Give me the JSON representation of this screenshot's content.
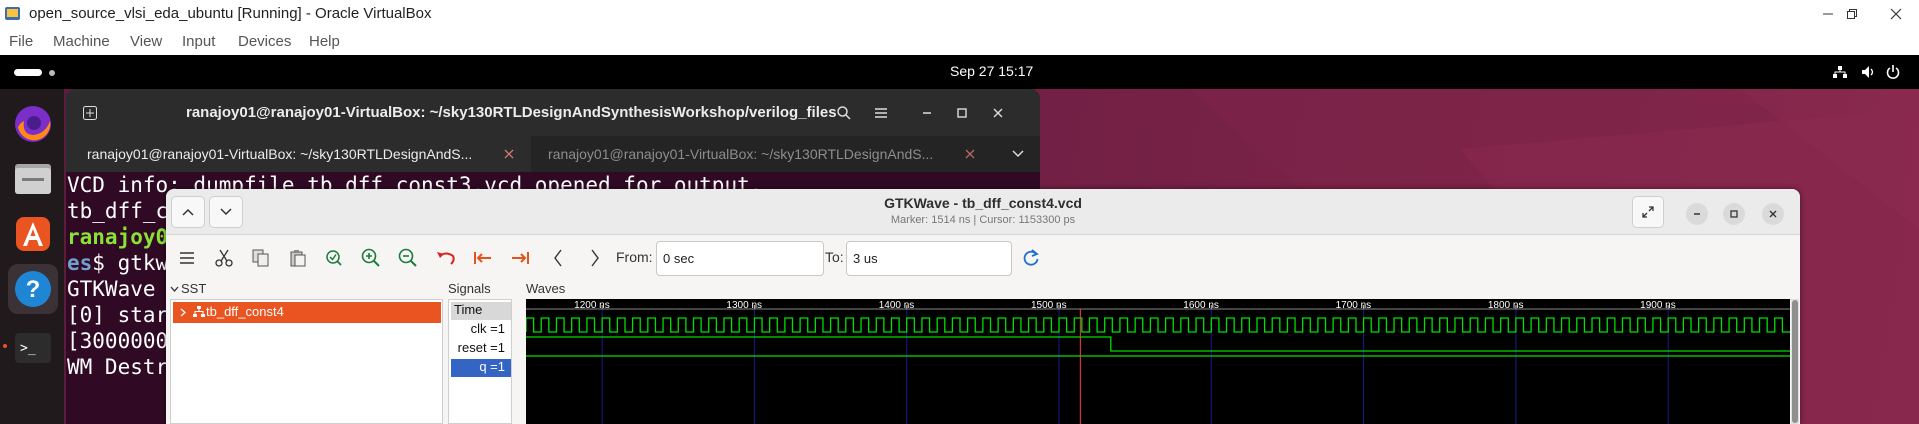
{
  "vbox": {
    "title": "open_source_vlsi_eda_ubuntu [Running] - Oracle VirtualBox",
    "menu": [
      "File",
      "Machine",
      "View",
      "Input",
      "Devices",
      "Help"
    ]
  },
  "guest": {
    "clock": "Sep 27  15:17"
  },
  "terminal": {
    "title": "ranajoy01@ranajoy01-VirtualBox: ~/sky130RTLDesignAndSynthesisWorkshop/verilog_files",
    "tabs": [
      {
        "label": "ranajoy01@ranajoy01-VirtualBox: ~/sky130RTLDesignAndS...",
        "active": true
      },
      {
        "label": "ranajoy01@ranajoy01-VirtualBox: ~/sky130RTLDesignAndS...",
        "active": false
      }
    ],
    "lines": [
      "VCD info: dumpfile tb_dff_const3.vcd opened for output.",
      "tb_dff_co",
      "ranajoy01",
      "es$ gtkwa",
      "",
      "GTKWave A",
      "",
      "[0] start",
      "[3000000",
      "WM Destro"
    ]
  },
  "gtkwave": {
    "title": "GTKWave - tb_dff_const4.vcd",
    "subtitle": "Marker: 1514 ns  |  Cursor: 1153300 ps",
    "from_label": "From:",
    "from_value": "0 sec",
    "to_label": "To:",
    "to_value": "3 us",
    "sst_header": "SST",
    "sst_item": "tb_dff_const4",
    "signals_header": "Signals",
    "waves_header": "Waves",
    "signals": [
      {
        "label": "Time",
        "type": "header"
      },
      {
        "label": "clk =1",
        "selected": false
      },
      {
        "label": "reset =1",
        "selected": false
      },
      {
        "label": "q =1",
        "selected": true
      }
    ],
    "time_ticks": [
      "1200 ns",
      "1300 ns",
      "1400 ns",
      "1500 ns",
      "1600 ns",
      "1700 ns",
      "1800 ns",
      "1900 ns"
    ],
    "wave_colors": {
      "signal": "#00e000",
      "grid": "#1a1a8c",
      "marker": "#ff4040",
      "text": "#ffffff"
    }
  },
  "chart_data": {
    "type": "line",
    "x_unit": "ns",
    "visible_range": [
      1150,
      1980
    ],
    "marker_ns": 1514,
    "clock_period_ns": 10,
    "series": [
      {
        "name": "clk",
        "kind": "clock"
      },
      {
        "name": "reset",
        "transitions": [
          [
            1150,
            1
          ],
          [
            1534,
            0
          ]
        ]
      },
      {
        "name": "q",
        "transitions": [
          [
            1150,
            1
          ]
        ]
      }
    ]
  }
}
